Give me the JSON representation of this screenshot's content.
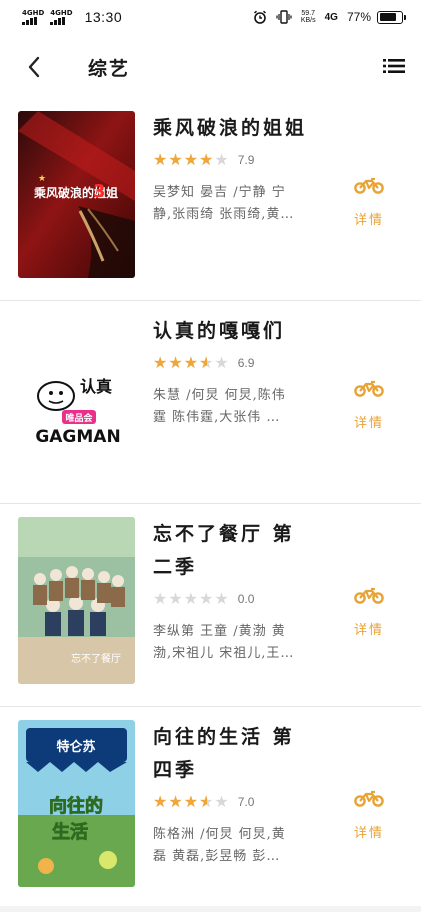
{
  "status_bar": {
    "signal1": "4GHD",
    "signal2": "4GHD",
    "time": "13:30",
    "net_speed_value": "59.7",
    "net_speed_unit": "KB/s",
    "network": "4G",
    "battery_percent": "77%",
    "battery_level": 0.77
  },
  "header": {
    "title": "综艺",
    "back_icon": "chevron-left-icon",
    "menu_icon": "list-icon"
  },
  "items": [
    {
      "title_line1": "乘风破浪的姐姐",
      "title_line2": "",
      "rating": 7.9,
      "score_text": "7.9",
      "stars_fraction": 0.8,
      "cast_line1": "吴梦知 晏吉 /宁静 宁",
      "cast_line2": "静,张雨绮 张雨绮,黄…",
      "detail_label": "详情",
      "poster_text": "乘风破浪的姐姐"
    },
    {
      "title_line1": "认真的嘎嘎们",
      "title_line2": "",
      "rating": 6.9,
      "score_text": "6.9",
      "stars_fraction": 0.7,
      "cast_line1": "朱慧 /何炅 何炅,陈伟",
      "cast_line2": "霆 陈伟霆,大张伟 …",
      "detail_label": "详情",
      "poster_text_top": "认真",
      "poster_text_mid": "唯品会",
      "poster_text_bottom": "GAGMAN"
    },
    {
      "title_line1": "忘不了餐厅 第",
      "title_line2": "二季",
      "rating": 0.0,
      "score_text": "0.0",
      "stars_fraction": 0.0,
      "cast_line1": "李纵第 王童 /黄渤 黄",
      "cast_line2": "渤,宋祖儿 宋祖儿,王…",
      "detail_label": "详情",
      "poster_text": "忘不了餐厅"
    },
    {
      "title_line1": "向往的生活 第",
      "title_line2": "四季",
      "rating": 7.0,
      "score_text": "7.0",
      "stars_fraction": 0.7,
      "cast_line1": "陈格洲 /何炅 何炅,黄",
      "cast_line2": "磊 黄磊,彭昱畅 彭…",
      "detail_label": "详情",
      "poster_text_top": "特仑苏",
      "poster_text_mid": "向往的",
      "poster_text_bottom": "生活"
    }
  ],
  "colors": {
    "accent": "#f0a73a",
    "detail": "#e8a335",
    "star_empty": "#d8d8d8"
  },
  "stars_glyphs": "★★★★★"
}
